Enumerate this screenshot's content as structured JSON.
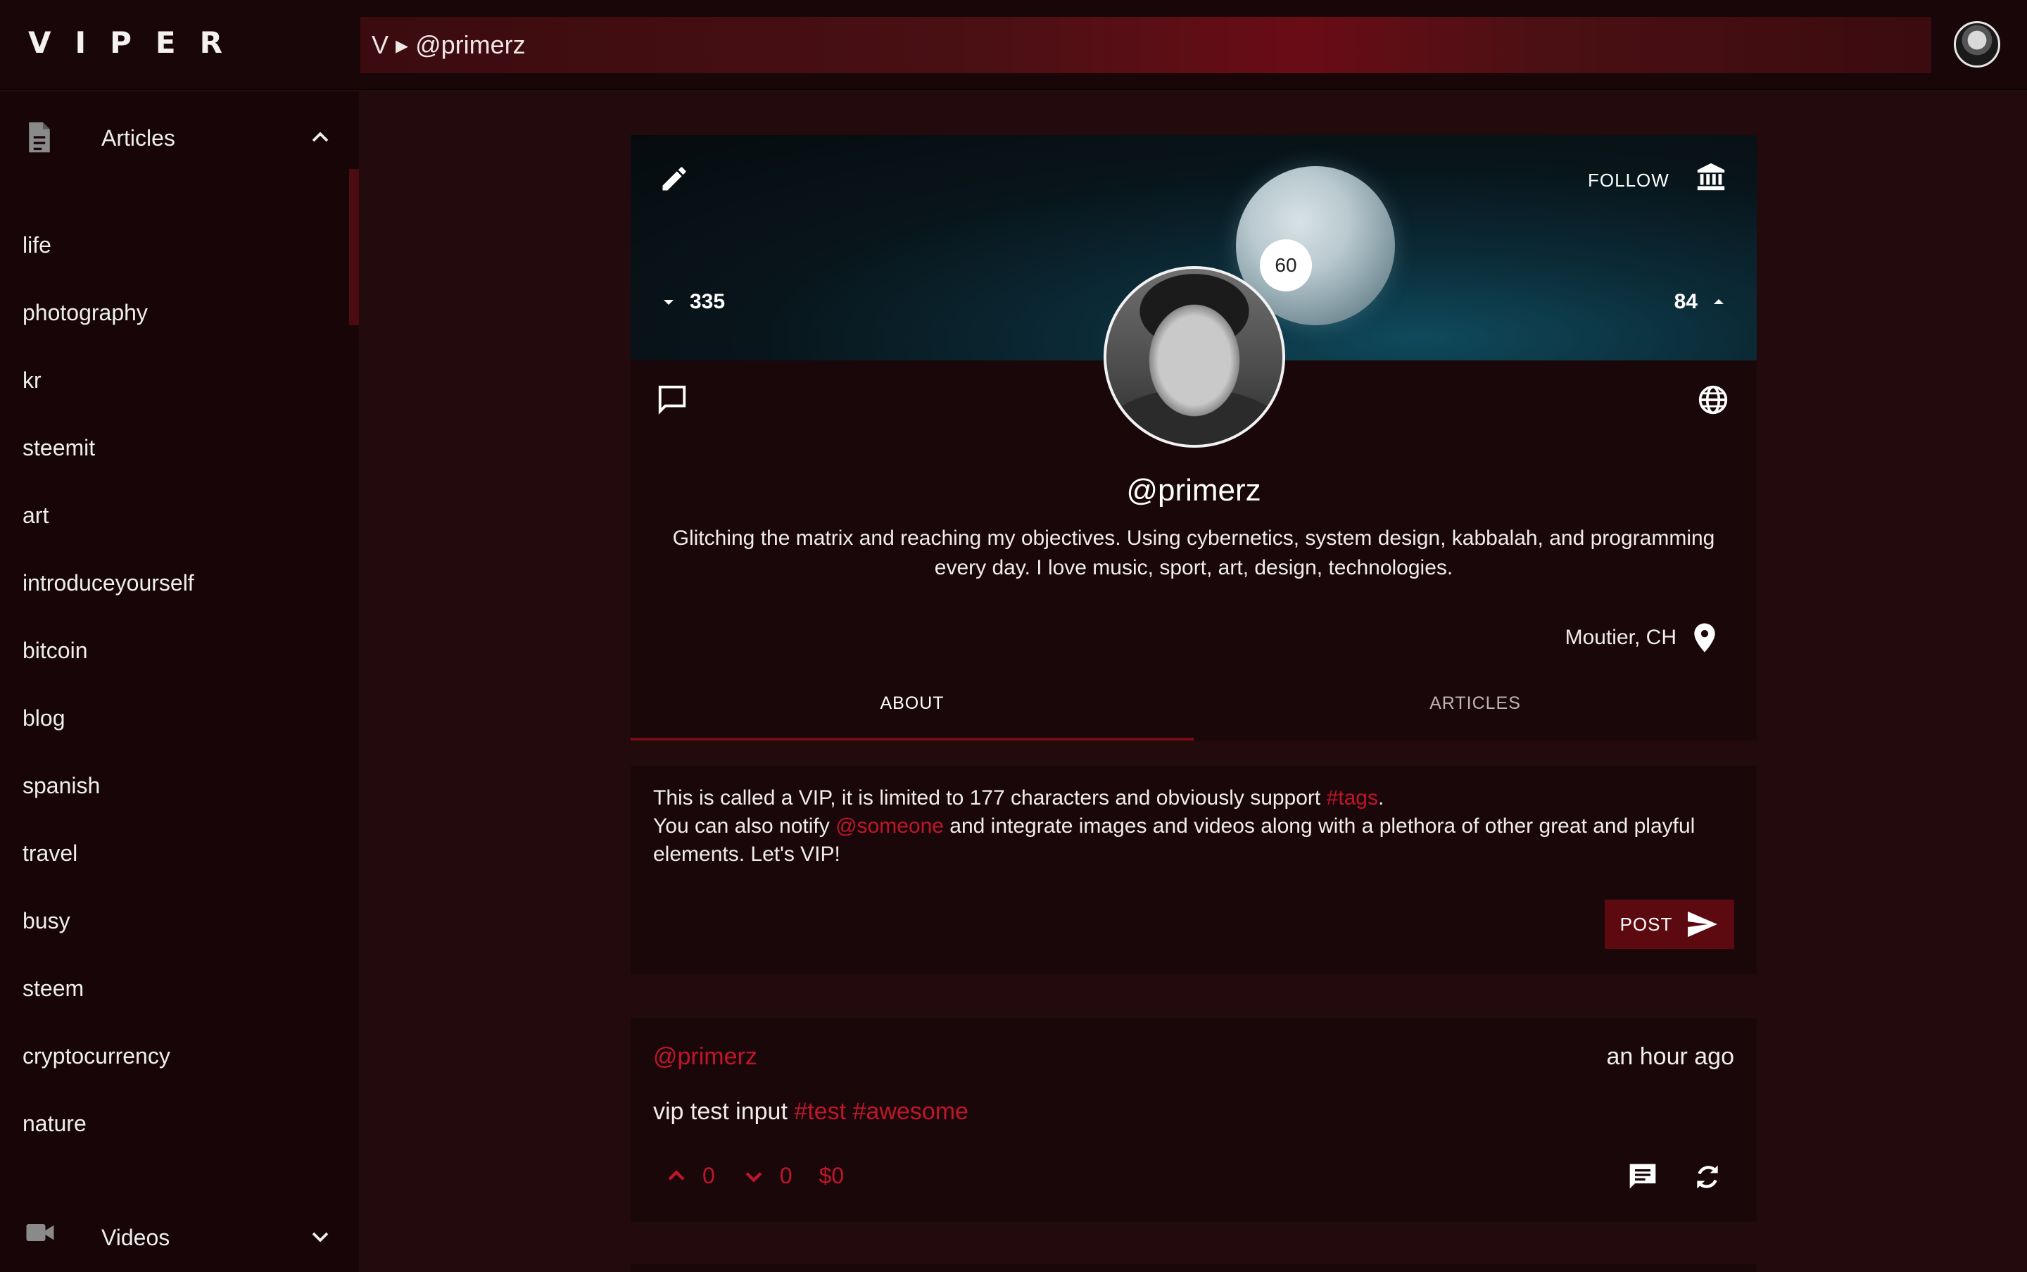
{
  "app": {
    "logo": "VIPER"
  },
  "search": {
    "path": "V ▸ @primerz"
  },
  "sidebar": {
    "section_title": "Articles",
    "items": [
      {
        "label": "life"
      },
      {
        "label": "photography"
      },
      {
        "label": "kr"
      },
      {
        "label": "steemit"
      },
      {
        "label": "art"
      },
      {
        "label": "introduceyourself"
      },
      {
        "label": "bitcoin"
      },
      {
        "label": "blog"
      },
      {
        "label": "spanish"
      },
      {
        "label": "travel"
      },
      {
        "label": "busy"
      },
      {
        "label": "steem"
      },
      {
        "label": "cryptocurrency"
      },
      {
        "label": "nature"
      }
    ],
    "footer_title": "Videos"
  },
  "profile": {
    "follow_label": "FOLLOW",
    "reputation": "60",
    "following_count": "335",
    "followers_count": "84",
    "username": "@primerz",
    "bio": "Glitching the matrix and reaching my objectives. Using cybernetics, system design, kabbalah, and programming every day. I love music, sport, art, design, technologies.",
    "location": "Moutier, CH",
    "tabs": [
      {
        "label": "ABOUT",
        "active": true
      },
      {
        "label": "ARTICLES",
        "active": false
      }
    ]
  },
  "composer": {
    "line1_prefix": "This is called a VIP,  it is limited to 177 characters and obviously support ",
    "line1_tag": "#tags",
    "line1_suffix": ".",
    "line2_prefix": "You can also notify ",
    "line2_mention": "@someone",
    "line2_suffix": " and integrate images and videos along with a plethora of  other great and playful elements. Let's VIP!",
    "post_label": "POST"
  },
  "post": {
    "author": "@primerz",
    "time": "an hour ago",
    "text": "vip test input ",
    "tags": "#test #awesome",
    "upvotes": "0",
    "downvotes": "0",
    "payout": "$0"
  },
  "colors": {
    "accent": "#c0162a",
    "background": "#230a0d",
    "card": "#190709",
    "button": "#5c0a10"
  }
}
